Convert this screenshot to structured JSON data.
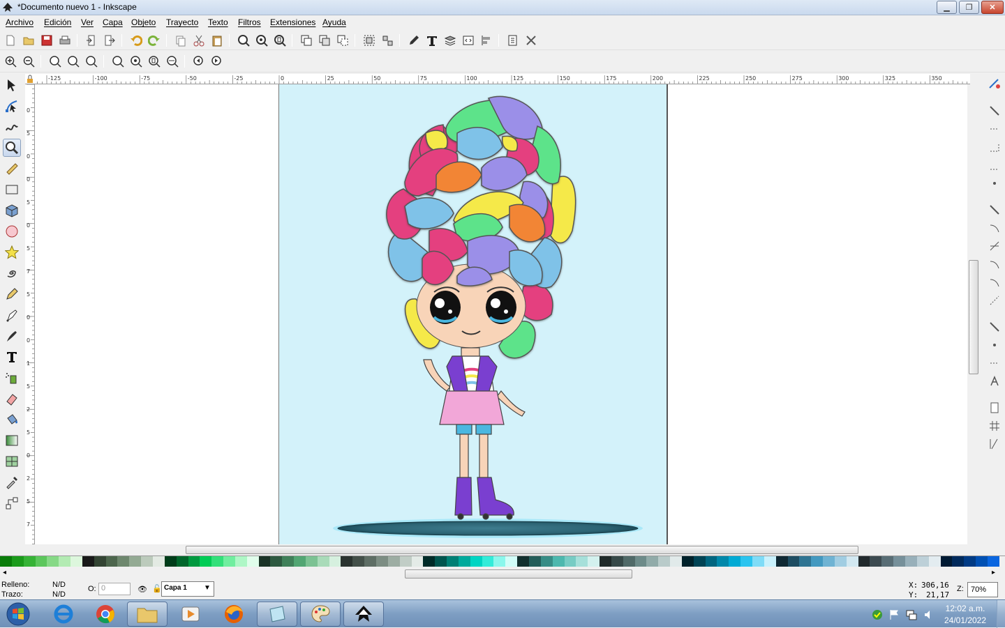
{
  "window": {
    "title": "*Documento nuevo 1 - Inkscape"
  },
  "menu": [
    "Archivo",
    "Edición",
    "Ver",
    "Capa",
    "Objeto",
    "Trayecto",
    "Texto",
    "Filtros",
    "Extensiones",
    "Ayuda"
  ],
  "ruler": {
    "top_labels": [
      "-125",
      "-100",
      "-75",
      "-50",
      "-25",
      "0",
      "25",
      "50",
      "75",
      "100",
      "125",
      "150",
      "175",
      "200",
      "225",
      "250",
      "275",
      "300",
      "325",
      "350"
    ],
    "left_labels": [
      "0",
      "5",
      "0",
      "0",
      "5",
      "0",
      "5",
      "7",
      "5",
      "0",
      "0",
      "1",
      "5",
      "2",
      "5",
      "0",
      "2",
      "5",
      "7",
      "5"
    ]
  },
  "status": {
    "fill_label": "Relleno:",
    "fill_value": "N/D",
    "stroke_label": "Trazo:",
    "stroke_value": "N/D",
    "opacity_label": "O:",
    "opacity_value": "0",
    "layer": "Capa 1",
    "x_label": "X:",
    "x_value": "306,16",
    "y_label": "Y:",
    "y_value": "21,17",
    "zoom_label": "Z:",
    "zoom_value": "70%"
  },
  "taskbar": {
    "time": "12:02 a.m.",
    "date": "24/01/2022"
  },
  "palette": [
    "#0a7d0a",
    "#1b9b1b",
    "#36b336",
    "#5cc75c",
    "#86d986",
    "#b3ebb3",
    "#ddf7dd",
    "#1a1a1a",
    "#334433",
    "#4d664d",
    "#6d876d",
    "#93aa93",
    "#bccbbc",
    "#e3eae3",
    "#003d1a",
    "#00662b",
    "#00993f",
    "#00cc55",
    "#33e07a",
    "#70ee9f",
    "#aef7c6",
    "#e0fdeb",
    "#1a3326",
    "#2d5940",
    "#3f8059",
    "#52a673",
    "#7cc293",
    "#a9dbb9",
    "#d6f0df",
    "#2a332f",
    "#435049",
    "#5e6e65",
    "#7c8d83",
    "#9dada3",
    "#c1cdc6",
    "#e4ebe7",
    "#002b28",
    "#00554e",
    "#008075",
    "#00aa9c",
    "#00d5c3",
    "#33ecd9",
    "#8af7ec",
    "#d1fdf8",
    "#12302e",
    "#245e5a",
    "#378d86",
    "#4db8ae",
    "#77ccc4",
    "#a6e0da",
    "#d3f1ee",
    "#1f2a29",
    "#364948",
    "#506a68",
    "#6d8b89",
    "#91aba9",
    "#b9cbca",
    "#e1eaea",
    "#00222b",
    "#004455",
    "#006680",
    "#0088aa",
    "#00aad4",
    "#2ac4ef",
    "#7fdcf7",
    "#c9f1fc",
    "#0f2833",
    "#1e4d62",
    "#2f7492",
    "#4399c0",
    "#6fb3d3",
    "#a1cde2",
    "#d2e8f1",
    "#222a2d",
    "#3c4a50",
    "#586d75",
    "#76909a",
    "#98b0ba",
    "#bdd0d8",
    "#e3ecf0",
    "#001a33",
    "#002a5c",
    "#003b85",
    "#0050b3",
    "#0a66e0"
  ],
  "colors": {
    "page": "#d3f2fa",
    "accent": "#3d6a9c"
  }
}
